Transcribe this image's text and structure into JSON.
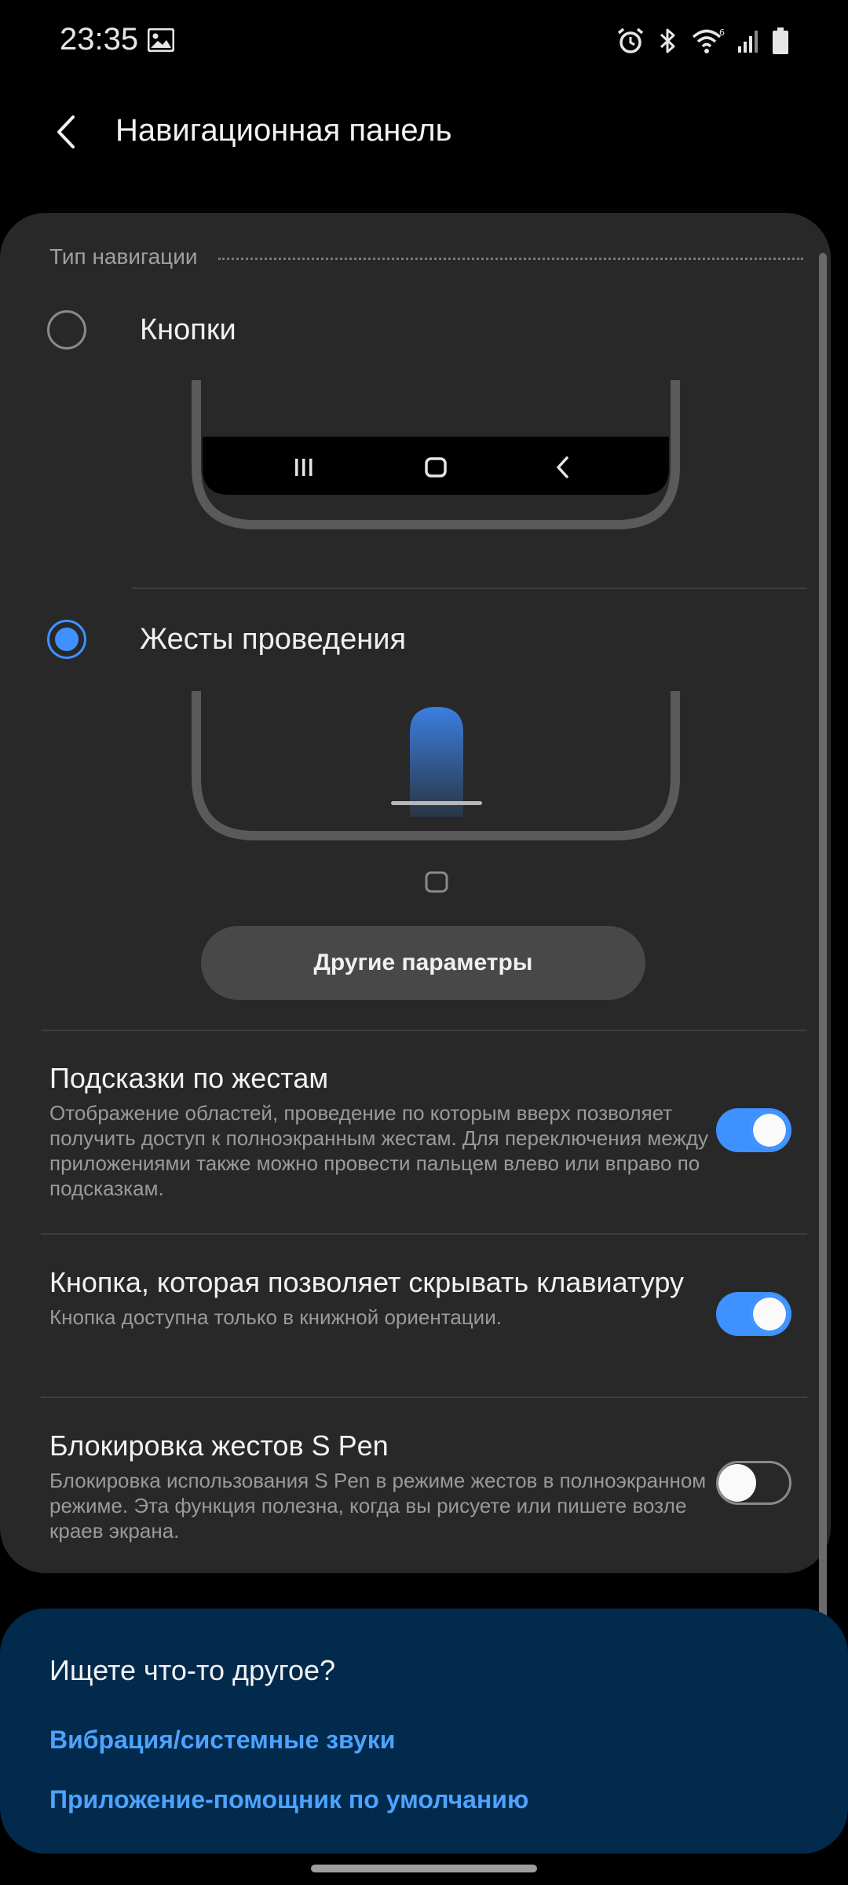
{
  "status_bar": {
    "time": "23:35",
    "icons": [
      "gallery-icon",
      "alarm-icon",
      "bluetooth-icon",
      "wifi-icon",
      "signal-icon",
      "battery-icon"
    ],
    "wifi_badge": "6"
  },
  "header": {
    "back_icon": "chevron-left-icon",
    "title": "Навигационная панель"
  },
  "navigation_type": {
    "section_label": "Тип навигации",
    "options": [
      {
        "label": "Кнопки",
        "selected": false
      },
      {
        "label": "Жесты проведения",
        "selected": true
      }
    ],
    "button_icons": [
      "recent-apps-icon",
      "home-icon",
      "back-icon"
    ],
    "other_params_label": "Другие параметры"
  },
  "settings": [
    {
      "title": "Подсказки по жестам",
      "description": "Отображение областей, проведение по которым вверх позволяет получить доступ к полноэкранным жестам. Для переключения между приложениями также можно провести пальцем влево или вправо по подсказкам.",
      "enabled": true
    },
    {
      "title": "Кнопка, которая позволяет скрывать клавиатуру",
      "description": "Кнопка доступна только в книжной ориентации.",
      "enabled": true
    },
    {
      "title": "Блокировка жестов S Pen",
      "description": "Блокировка использования S Pen в режиме жестов в полноэкранном режиме. Эта функция полезна, когда вы рисуете или пишете возле краев экрана.",
      "enabled": false
    }
  ],
  "suggestions": {
    "title": "Ищете что-то другое?",
    "links": [
      "Вибрация/системные звуки",
      "Приложение-помощник по умолчанию"
    ]
  },
  "colors": {
    "accent": "#3e91ff",
    "card_bg": "#282828",
    "suggest_bg": "#012a4c",
    "link": "#4da3ff"
  }
}
